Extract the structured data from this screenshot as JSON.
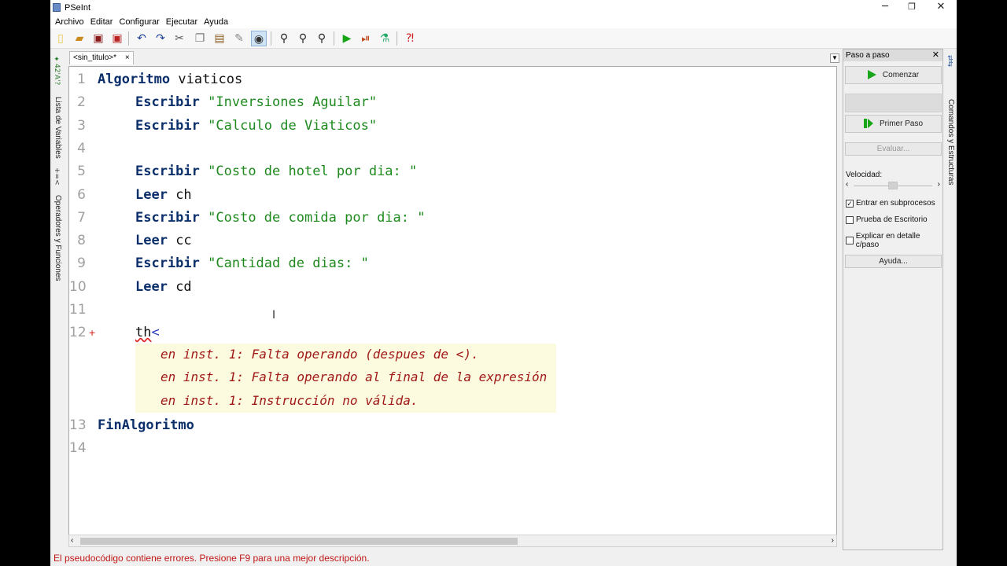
{
  "window": {
    "title": "PSeInt",
    "minimize": "─",
    "restore": "❐",
    "close": "✕"
  },
  "menu": [
    "Archivo",
    "Editar",
    "Configurar",
    "Ejecutar",
    "Ayuda"
  ],
  "toolbar": {
    "icons": [
      "new-file-icon",
      "open-folder-icon",
      "save-icon",
      "save-as-icon",
      "undo-icon",
      "redo-icon",
      "cut-icon",
      "copy-icon",
      "paste-icon",
      "edit-icon",
      "view-icon",
      "find-icon",
      "find-next-icon",
      "replace-icon",
      "run-icon",
      "step-icon",
      "debug-icon",
      "help-icon"
    ]
  },
  "left_strip": {
    "variables_label": "Lista de Variables",
    "operators_label": "Operadores y Funciones"
  },
  "tab": {
    "label": "<sin_titulo>*",
    "close": "×"
  },
  "editor": {
    "lines": [
      {
        "n": "1",
        "kw": "Algoritmo",
        "rest": " viaticos",
        "str": "",
        "indent": 0
      },
      {
        "n": "2",
        "kw": "Escribir",
        "rest": " ",
        "str": "\"Inversiones Aguilar\"",
        "indent": 1
      },
      {
        "n": "3",
        "kw": "Escribir",
        "rest": " ",
        "str": "\"Calculo de Viaticos\"",
        "indent": 1
      },
      {
        "n": "4",
        "kw": "",
        "rest": "",
        "str": "",
        "indent": 0
      },
      {
        "n": "5",
        "kw": "Escribir",
        "rest": " ",
        "str": "\"Costo de hotel por dia: \"",
        "indent": 1
      },
      {
        "n": "6",
        "kw": "Leer",
        "rest": " ch",
        "str": "",
        "indent": 1
      },
      {
        "n": "7",
        "kw": "Escribir",
        "rest": " ",
        "str": "\"Costo de comida por dia: \"",
        "indent": 1
      },
      {
        "n": "8",
        "kw": "Leer",
        "rest": " cc",
        "str": "",
        "indent": 1
      },
      {
        "n": "9",
        "kw": "Escribir",
        "rest": " ",
        "str": "\"Cantidad de dias: \"",
        "indent": 1
      },
      {
        "n": "10",
        "kw": "Leer",
        "rest": " cd",
        "str": "",
        "indent": 1
      },
      {
        "n": "11",
        "kw": "",
        "rest": "",
        "str": "",
        "indent": 0
      },
      {
        "n": "12",
        "kw": "",
        "rest": "th<",
        "str": "",
        "indent": 1
      }
    ],
    "error_marker": "+",
    "errors": [
      "en inst. 1: Falta operando (despues de <).",
      "en inst. 1: Falta operando al final de la expresión",
      "en inst. 1: Instrucción no válida."
    ],
    "after": [
      {
        "n": "13",
        "kw": "FinAlgoritmo",
        "rest": "",
        "str": "",
        "indent": 0
      },
      {
        "n": "14",
        "kw": "",
        "rest": "",
        "str": "",
        "indent": 0
      }
    ],
    "cursor": "I"
  },
  "panel": {
    "title": "Paso a paso",
    "close": "✕",
    "start_label": "Comenzar",
    "first_step_label": "Primer Paso",
    "evaluate_label": "Evaluar...",
    "speed_label": "Velocidad:",
    "speed_level": 0.5,
    "options": [
      {
        "label": "Entrar en subprocesos",
        "checked": true
      },
      {
        "label": "Prueba de Escritorio",
        "checked": false
      },
      {
        "label": "Explicar en detalle c/paso",
        "checked": false
      }
    ],
    "help_label": "Ayuda..."
  },
  "right_strip": {
    "label": "Comandos y Estructuras"
  },
  "status": "El pseudocódigo contiene errores. Presione F9 para una mejor descripción."
}
